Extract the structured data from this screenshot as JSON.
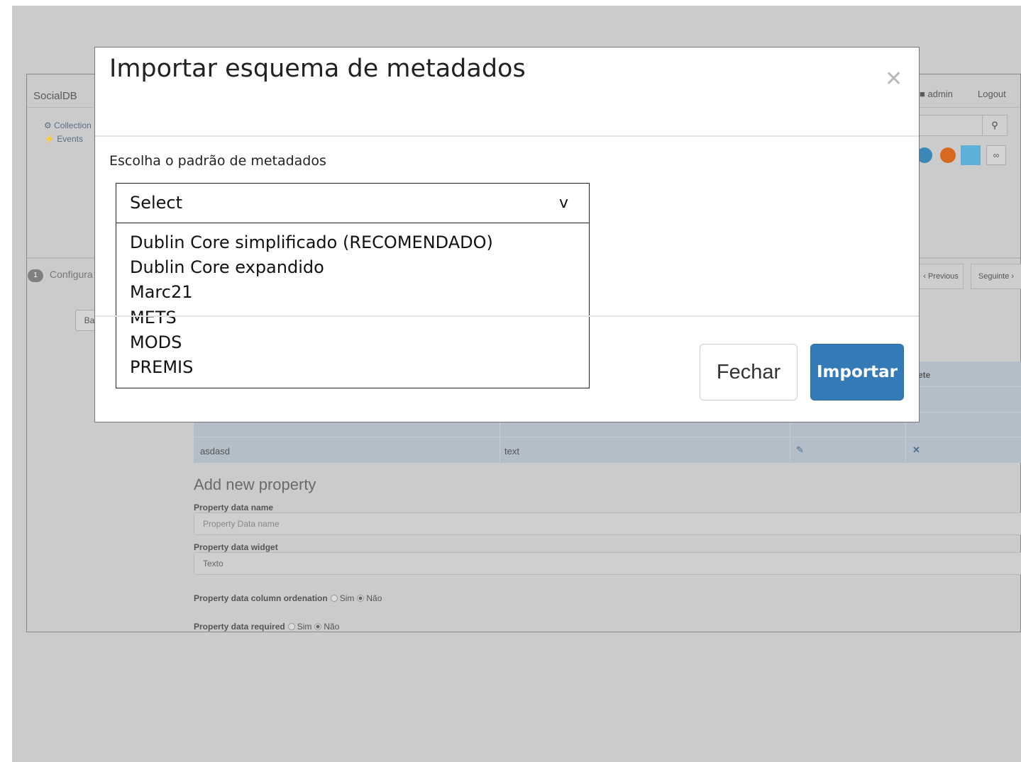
{
  "app": {
    "brand": "SocialDB",
    "user": "admin",
    "logout": "Logout",
    "side_links": [
      "Collection",
      "Events"
    ],
    "step_number": "1",
    "step_label": "Configura",
    "pager_previous": "Previous",
    "pager_next": "Seguinte",
    "back_button": "Ba",
    "table_header_delete": "elete",
    "table_row": {
      "name": "asdasd",
      "type": "text"
    },
    "add_property_title": "Add new property",
    "property_name_label": "Property data name",
    "property_name_placeholder": "Property Data name",
    "property_widget_label": "Property data widget",
    "property_widget_value": "Texto",
    "ordenation_label": "Property data column ordenation",
    "required_label": "Property data required",
    "radio_yes": "Sim",
    "radio_no": "Não",
    "colors": {
      "twitter": "#3a87b8",
      "rss": "#d7681f",
      "export": "#5fb0d9"
    }
  },
  "modal": {
    "title": "Importar esquema de metadados",
    "close_glyph": "✕",
    "label": "Escolha o padrão de metadados",
    "select": {
      "value": "Select",
      "arrow": "v",
      "options": [
        "Dublin Core simplificado (RECOMENDADO)",
        "Dublin Core expandido",
        "Marc21",
        "METS",
        "MODS",
        "PREMIS"
      ]
    },
    "buttons": {
      "close": "Fechar",
      "import": "Importar"
    },
    "colors": {
      "primary": "#347ab7"
    }
  }
}
